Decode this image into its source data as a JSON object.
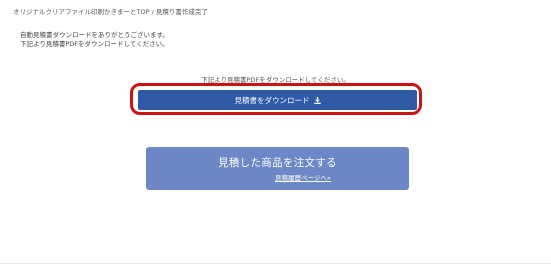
{
  "breadcrumb": {
    "text": "オリジナルクリアファイル印刷かきまーとTOP / 見積り書作成完了"
  },
  "intro": {
    "line1": "自動見積書ダウンロードをありがとうございます。",
    "line2": "下記より見積書PDFをダウンロードしてください。"
  },
  "download": {
    "caption": "下記より見積書PDFをダウンロードしてください。",
    "button_label": "見積書をダウンロード",
    "icon": "download-icon",
    "button_color": "#2f5aa8",
    "highlight_color": "#cc1313"
  },
  "order": {
    "title": "見積した商品を注文する",
    "history_link": "見積履歴ページへ»",
    "card_color": "#6d88c6"
  }
}
